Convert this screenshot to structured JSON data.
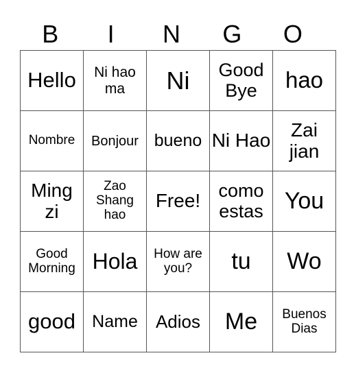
{
  "header": [
    "B",
    "I",
    "N",
    "G",
    "O"
  ],
  "rows": [
    [
      {
        "t": "Hello",
        "s": 31
      },
      {
        "t": "Ni hao ma",
        "s": 21
      },
      {
        "t": "Ni",
        "s": 36
      },
      {
        "t": "Good Bye",
        "s": 27
      },
      {
        "t": "hao",
        "s": 33
      }
    ],
    [
      {
        "t": "Nombre",
        "s": 19
      },
      {
        "t": "Bonjour",
        "s": 20
      },
      {
        "t": "bueno",
        "s": 25
      },
      {
        "t": "Ni Hao",
        "s": 28
      },
      {
        "t": "Zai jian",
        "s": 28
      }
    ],
    [
      {
        "t": "Ming zi",
        "s": 28
      },
      {
        "t": "Zao Shang hao",
        "s": 19
      },
      {
        "t": "Free!",
        "s": 28
      },
      {
        "t": "como estas",
        "s": 27
      },
      {
        "t": "You",
        "s": 34
      }
    ],
    [
      {
        "t": "Good Morning",
        "s": 19
      },
      {
        "t": "Hola",
        "s": 32
      },
      {
        "t": "How are you?",
        "s": 19
      },
      {
        "t": "tu",
        "s": 34
      },
      {
        "t": "Wo",
        "s": 34
      }
    ],
    [
      {
        "t": "good",
        "s": 31
      },
      {
        "t": "Name",
        "s": 25
      },
      {
        "t": "Adios",
        "s": 26
      },
      {
        "t": "Me",
        "s": 34
      },
      {
        "t": "Buenos Dias",
        "s": 19
      }
    ]
  ]
}
